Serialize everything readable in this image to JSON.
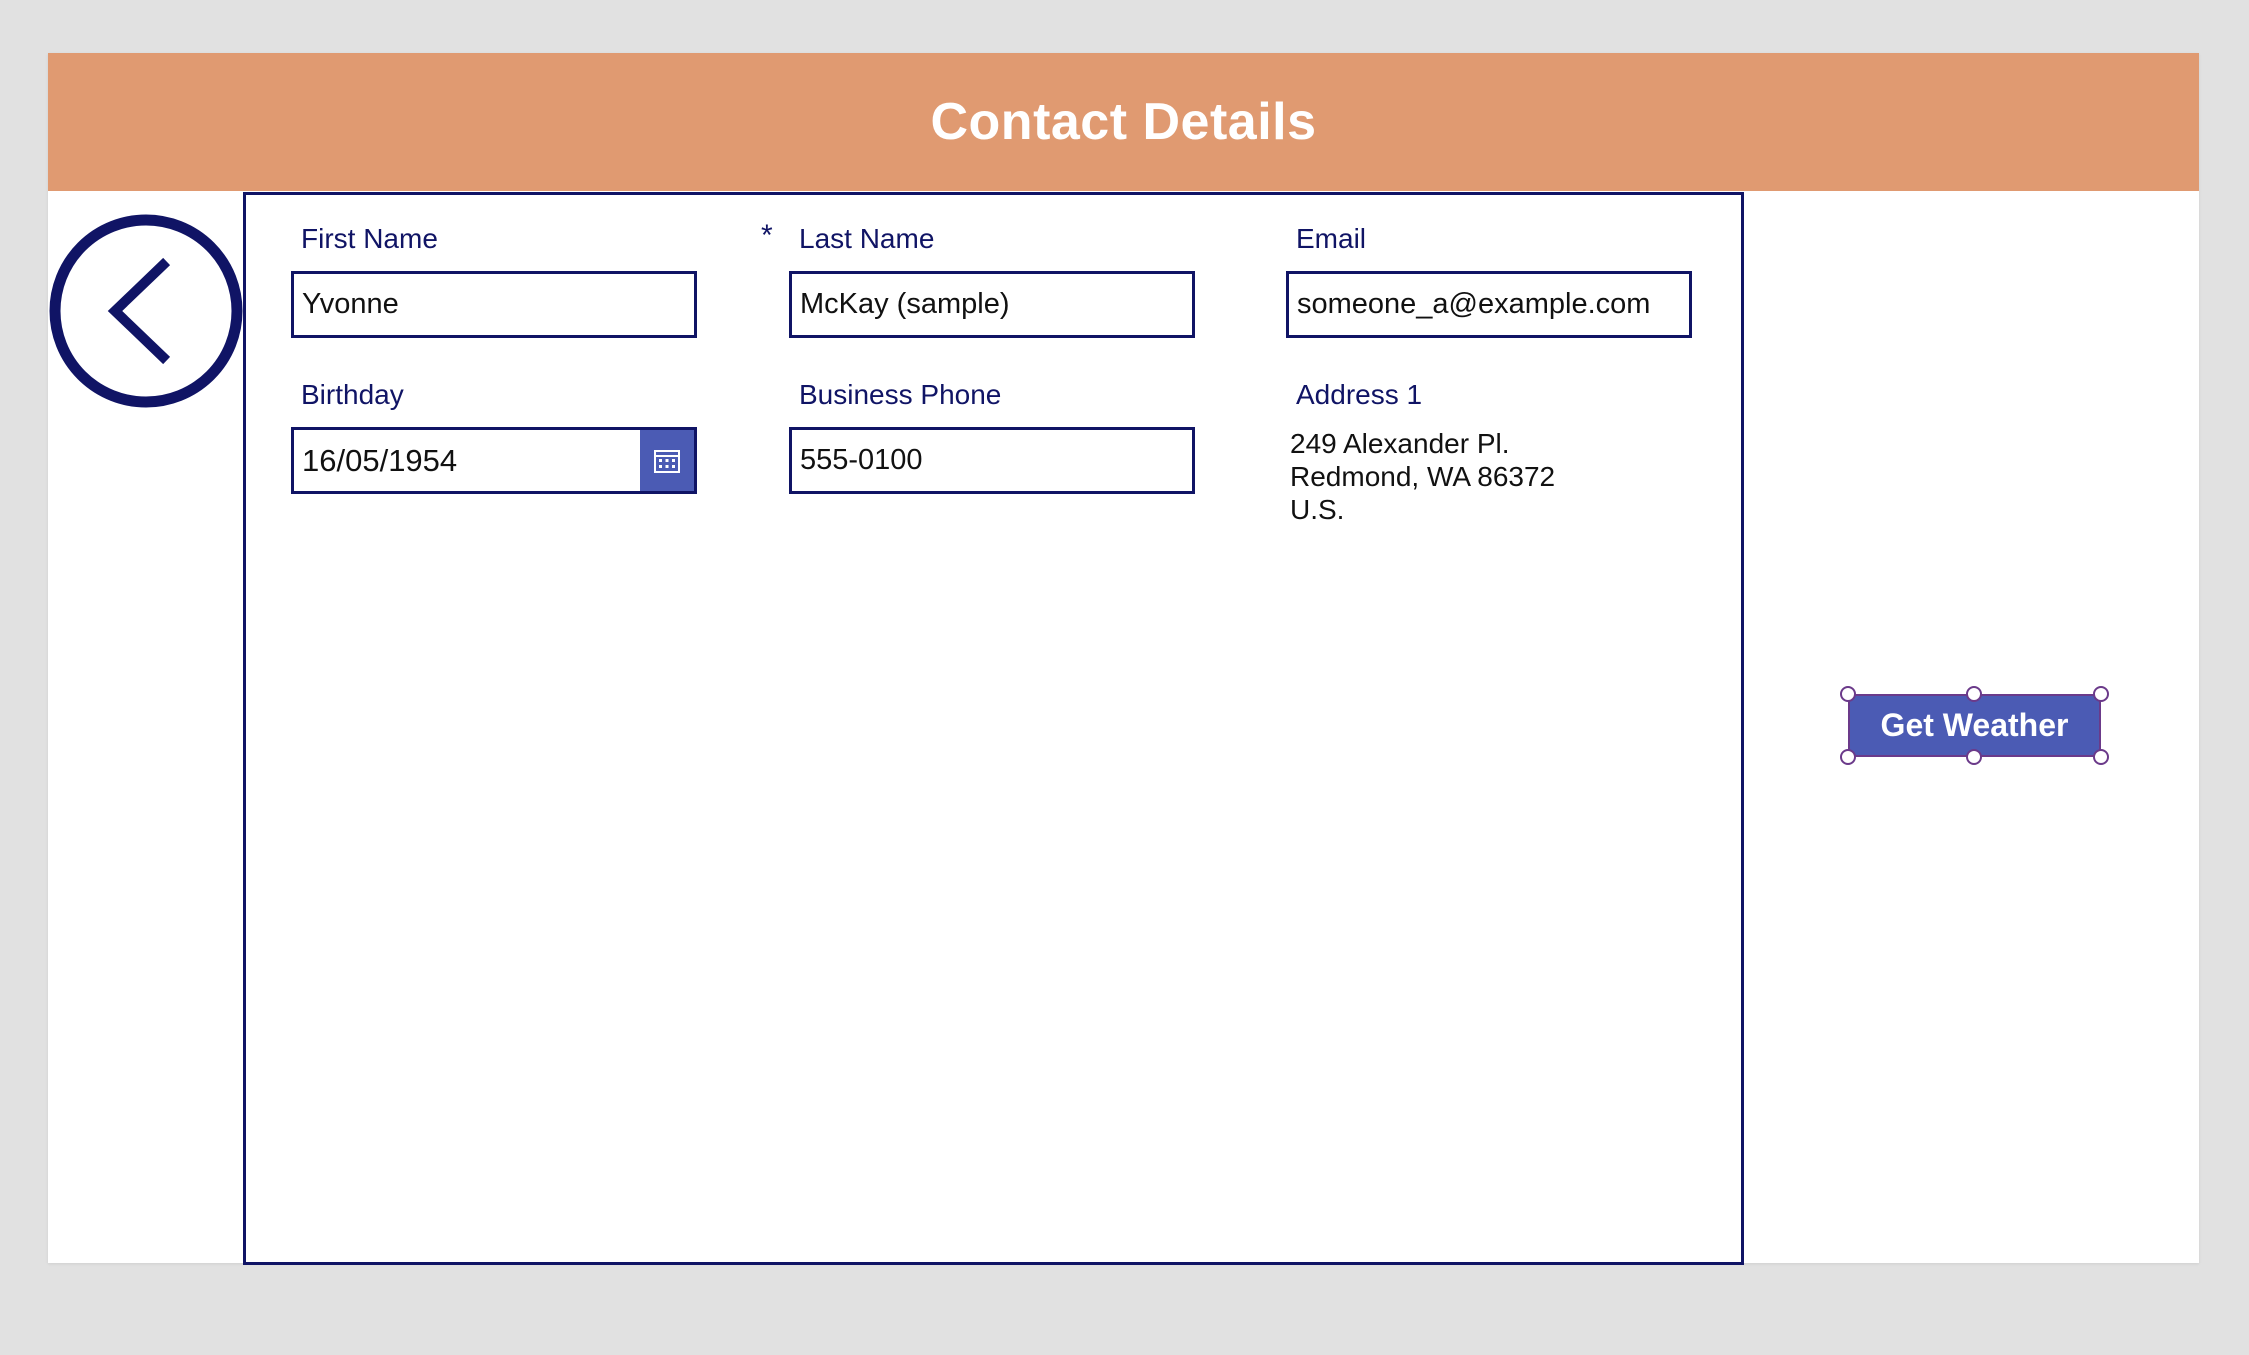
{
  "header": {
    "title": "Contact Details"
  },
  "icons": {
    "back": "chevron-left-in-circle-icon",
    "calendar": "calendar-icon"
  },
  "form": {
    "first_name": {
      "label": "First Name",
      "value": "Yvonne"
    },
    "last_name": {
      "required_marker": "*",
      "label": "Last Name",
      "value": "McKay (sample)"
    },
    "email": {
      "label": "Email",
      "value": "someone_a@example.com"
    },
    "birthday": {
      "label": "Birthday",
      "value": "16/05/1954"
    },
    "business_phone": {
      "label": "Business Phone",
      "value": "555-0100"
    },
    "address": {
      "label": "Address 1",
      "line1": "249 Alexander Pl.",
      "line2": "Redmond, WA 86372",
      "line3": "U.S."
    }
  },
  "weather_button": {
    "label": "Get Weather"
  },
  "colors": {
    "header": "#e09a71",
    "navy": "#101465",
    "button": "#4b5bb4",
    "selection": "#6b3a8a"
  }
}
